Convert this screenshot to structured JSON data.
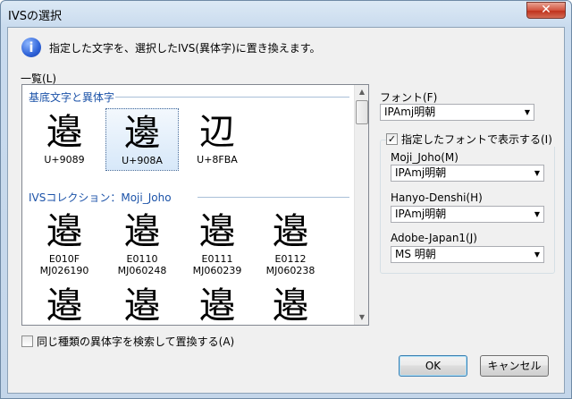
{
  "window": {
    "title": "IVSの選択",
    "close": "✕"
  },
  "message": "指定した文字を、選択したIVS(異体字)に置き換えます。",
  "list_label": "一覧(L)",
  "section1": {
    "title": "基底文字と異体字",
    "items": [
      {
        "glyph": "邉",
        "code": "U+9089"
      },
      {
        "glyph": "邊",
        "code": "U+908A"
      },
      {
        "glyph": "辺",
        "code": "U+8FBA"
      }
    ]
  },
  "section2": {
    "title": "IVSコレクション：Moji_Joho",
    "items": [
      {
        "glyph": "邉",
        "code1": "E010F",
        "code2": "MJ026190"
      },
      {
        "glyph": "邉",
        "code1": "E0110",
        "code2": "MJ060248"
      },
      {
        "glyph": "邉",
        "code1": "E0111",
        "code2": "MJ060239"
      },
      {
        "glyph": "邉",
        "code1": "E0112",
        "code2": "MJ060238"
      }
    ],
    "row3": [
      "邉",
      "邉",
      "邉",
      "邉"
    ]
  },
  "search_replace": "同じ種類の異体字を検索して置換する(A)",
  "font": {
    "label": "フォント(F)",
    "value": "IPAmj明朝"
  },
  "display_with_font": "指定したフォントで表示する(I)",
  "fields": {
    "moji_joho": {
      "label": "Moji_Joho(M)",
      "value": "IPAmj明朝"
    },
    "hanyo_denshi": {
      "label": "Hanyo-Denshi(H)",
      "value": "IPAmj明朝"
    },
    "adobe_japan1": {
      "label": "Adobe-Japan1(J)",
      "value": "MS 明朝"
    }
  },
  "buttons": {
    "ok": "OK",
    "cancel": "キャンセル"
  },
  "icons": {
    "info": "i",
    "arrow": "▼",
    "check": "✓",
    "scroll_up": "▲",
    "scroll_down": "▼"
  }
}
